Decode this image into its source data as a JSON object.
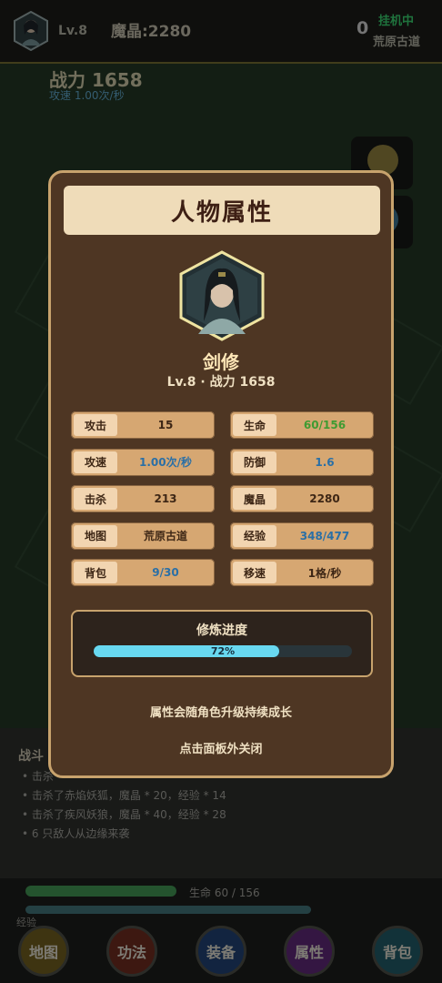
{
  "topbar": {
    "level": "Lv.8",
    "crystal": "魔晶:2280",
    "counter": "0",
    "status": "挂机中",
    "map": "荒原古道"
  },
  "scene": {
    "power": "战力 1658",
    "attack_speed": "攻速 1.00次/秒"
  },
  "modal": {
    "title": "人物属性",
    "name": "剑修",
    "subtitle": "Lv.8 · 战力 1658",
    "stats": [
      {
        "label": "攻击",
        "value": "15",
        "color": "#3d2615"
      },
      {
        "label": "生命",
        "value": "60/156",
        "color": "#3f9b32"
      },
      {
        "label": "攻速",
        "value": "1.00次/秒",
        "color": "#2a6fa6"
      },
      {
        "label": "防御",
        "value": "1.6",
        "color": "#2a6fa6"
      },
      {
        "label": "击杀",
        "value": "213",
        "color": "#3d2615"
      },
      {
        "label": "魔晶",
        "value": "2280",
        "color": "#3d2615"
      },
      {
        "label": "地图",
        "value": "荒原古道",
        "color": "#3d2615"
      },
      {
        "label": "经验",
        "value": "348/477",
        "color": "#2a6fa6"
      },
      {
        "label": "背包",
        "value": "9/30",
        "color": "#2a6fa6"
      },
      {
        "label": "移速",
        "value": "1格/秒",
        "color": "#3d2615"
      }
    ],
    "progress": {
      "title": "修炼进度",
      "value": 0.72,
      "label": "72%"
    },
    "tip1": "属性会随角色升级持续成长",
    "tip2": "点击面板外关闭"
  },
  "log": {
    "title": "战斗",
    "lines": [
      "击杀",
      "击杀了赤焰妖狐，魔晶 * 20，经验 * 14",
      "击杀了疾风妖狼，魔晶 * 40，经验 * 28",
      "6 只敌人从边缘来袭"
    ]
  },
  "bottom": {
    "hp_label": "生命 60 / 156",
    "hp_fraction": 0.385,
    "exp_label": "经验",
    "exp_fraction": 0.73,
    "nav": [
      {
        "label": "地图",
        "color": "#6b5a1e"
      },
      {
        "label": "功法",
        "color": "#6a2a1e"
      },
      {
        "label": "装备",
        "color": "#1f3f6e"
      },
      {
        "label": "属性",
        "color": "#5a2772"
      },
      {
        "label": "背包",
        "color": "#1f5662"
      }
    ]
  },
  "icons": {
    "avatar": "hero-portrait-icon",
    "side1": "chest-icon",
    "side2": "orb-icon"
  }
}
